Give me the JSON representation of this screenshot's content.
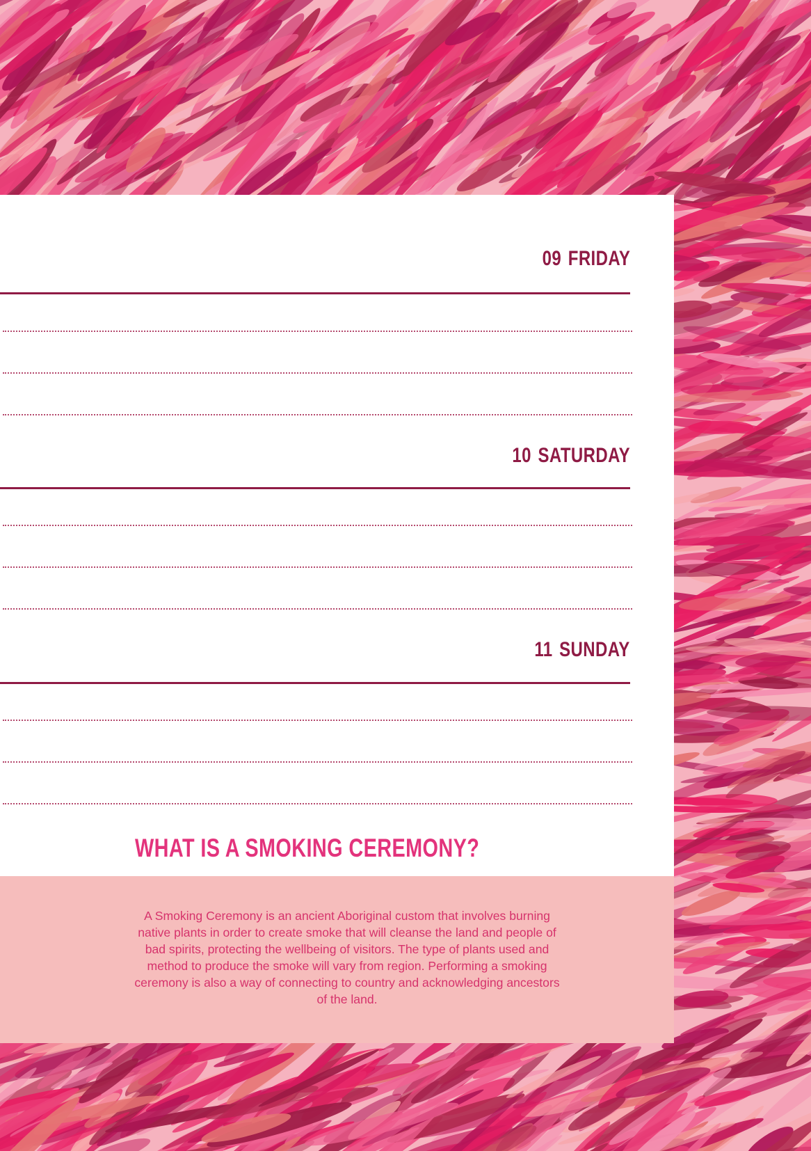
{
  "days": [
    {
      "number": "09",
      "name": "FRIDAY"
    },
    {
      "number": "10",
      "name": "SATURDAY"
    },
    {
      "number": "11",
      "name": "SUNDAY"
    }
  ],
  "info": {
    "heading": "WHAT IS A SMOKING CEREMONY?",
    "body": "A Smoking Ceremony is an ancient Aboriginal custom that involves burning native plants in order to create smoke that will cleanse the land and people of bad spirits, protecting the wellbeing of visitors. The type of plants used and method to produce the smoke will vary from region. Performing a smoking ceremony is also a way of connecting to country and acknowledging ancestors of the land."
  },
  "colors": {
    "day_title": "#8f1b45",
    "heading": "#e3337c",
    "info_box": "#f6bdbc",
    "info_text": "#d6336c",
    "background_base": "#f6b3bf"
  },
  "decoration": "pink-watercolor-brushstroke-pattern"
}
